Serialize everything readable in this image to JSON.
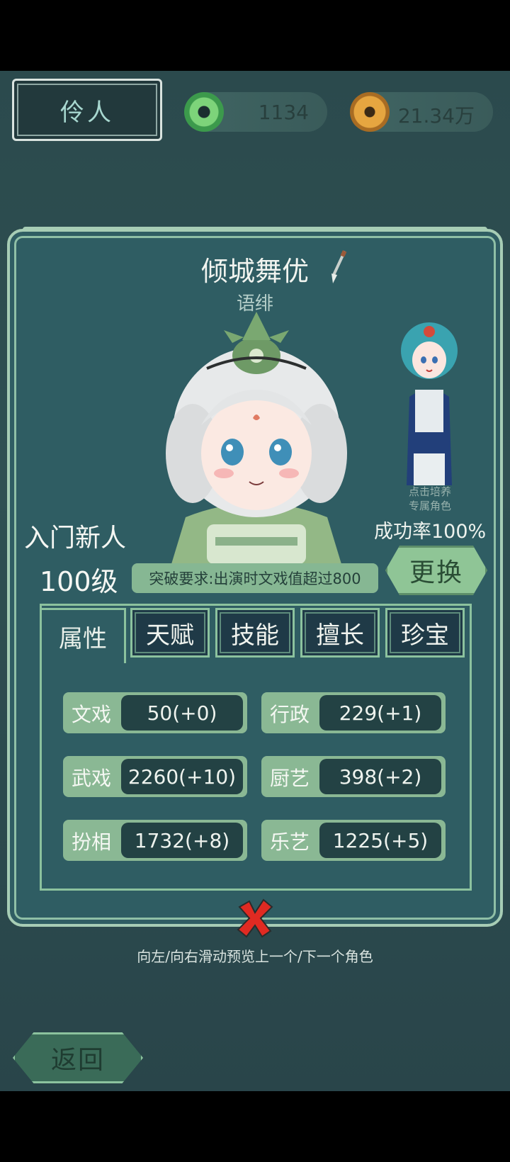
{
  "header": {
    "title": "伶人",
    "jade_value": "1134",
    "coin_value": "21.34万"
  },
  "character": {
    "name": "倾城舞优",
    "sub_name": "语绯",
    "rank": "入门新人",
    "level": "100级",
    "breakthrough_req": "突破要求:出演时文戏值超过800",
    "change_label": "更换",
    "side_hint_line1": "点击培养",
    "side_hint_line2": "专属角色",
    "success_rate": "成功率100%"
  },
  "tabs": [
    {
      "label": "属性",
      "active": true
    },
    {
      "label": "天赋",
      "active": false
    },
    {
      "label": "技能",
      "active": false
    },
    {
      "label": "擅长",
      "active": false
    },
    {
      "label": "珍宝",
      "active": false
    }
  ],
  "stats": [
    {
      "label": "文戏",
      "value": "50(+0)"
    },
    {
      "label": "行政",
      "value": "229(+1)"
    },
    {
      "label": "武戏",
      "value": "2260(+10)"
    },
    {
      "label": "厨艺",
      "value": "398(+2)"
    },
    {
      "label": "扮相",
      "value": "1732(+8)"
    },
    {
      "label": "乐艺",
      "value": "1225(+5)"
    }
  ],
  "footer": {
    "swipe_hint": "向左/向右滑动预览上一个/下一个角色",
    "back_label": "返回"
  }
}
